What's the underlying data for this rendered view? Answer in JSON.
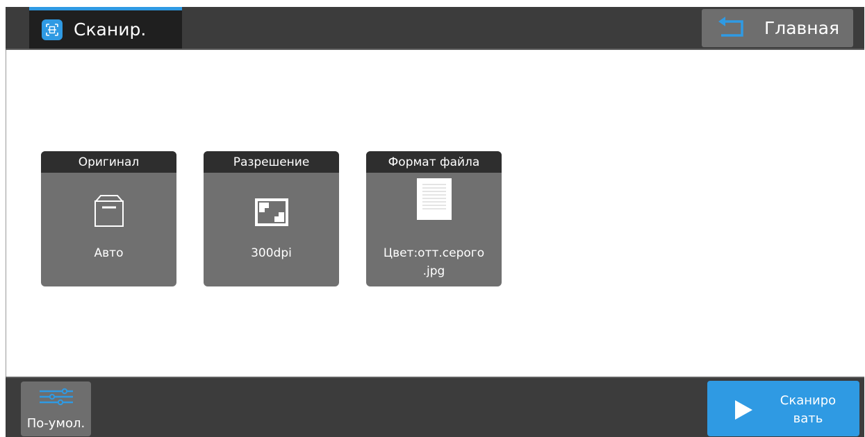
{
  "header": {
    "app_title": "Сканир.",
    "app_icon": "scan-icon",
    "home_label": "Главная",
    "home_icon": "return-arrow-icon"
  },
  "tiles": [
    {
      "title": "Оригинал",
      "value": "Авто",
      "icon": "box-icon"
    },
    {
      "title": "Разрешение",
      "value": "300dpi",
      "icon": "resolution-icon"
    },
    {
      "title": "Формат файла",
      "value_line1": "Цвет:отт.серого",
      "value_line2": ".jpg",
      "icon": "document-icon"
    }
  ],
  "footer": {
    "defaults_label": "По-умол.",
    "defaults_icon": "sliders-icon",
    "scan_label_line1": "Сканиро",
    "scan_label_line2": "вать",
    "scan_icon": "play-icon"
  },
  "colors": {
    "accent": "#2f9ae3",
    "bar_bg": "#3c3c3c",
    "tile_bg": "#707070",
    "tile_header": "#2e2e2e",
    "button_gray": "#6e6e6e"
  }
}
